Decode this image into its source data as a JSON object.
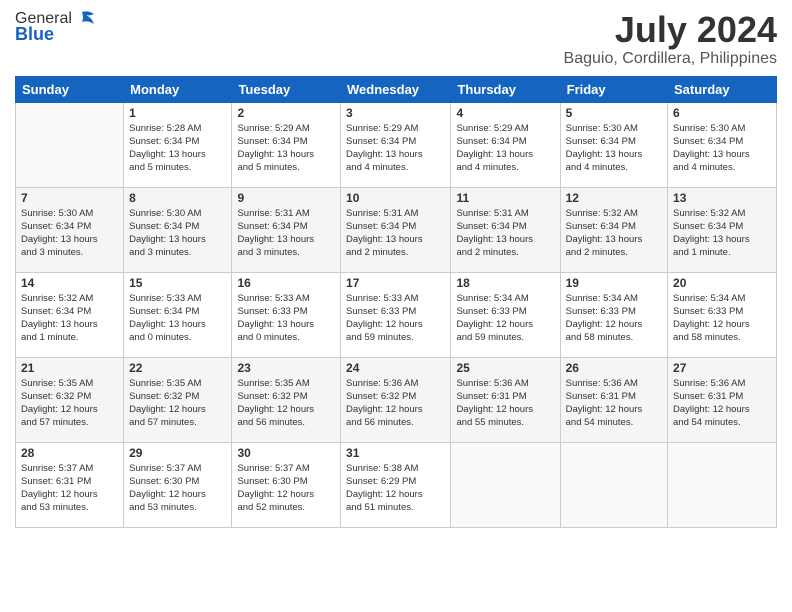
{
  "header": {
    "logo_general": "General",
    "logo_blue": "Blue",
    "month_title": "July 2024",
    "location": "Baguio, Cordillera, Philippines"
  },
  "days_of_week": [
    "Sunday",
    "Monday",
    "Tuesday",
    "Wednesday",
    "Thursday",
    "Friday",
    "Saturday"
  ],
  "weeks": [
    [
      {
        "day": "",
        "info": ""
      },
      {
        "day": "1",
        "info": "Sunrise: 5:28 AM\nSunset: 6:34 PM\nDaylight: 13 hours\nand 5 minutes."
      },
      {
        "day": "2",
        "info": "Sunrise: 5:29 AM\nSunset: 6:34 PM\nDaylight: 13 hours\nand 5 minutes."
      },
      {
        "day": "3",
        "info": "Sunrise: 5:29 AM\nSunset: 6:34 PM\nDaylight: 13 hours\nand 4 minutes."
      },
      {
        "day": "4",
        "info": "Sunrise: 5:29 AM\nSunset: 6:34 PM\nDaylight: 13 hours\nand 4 minutes."
      },
      {
        "day": "5",
        "info": "Sunrise: 5:30 AM\nSunset: 6:34 PM\nDaylight: 13 hours\nand 4 minutes."
      },
      {
        "day": "6",
        "info": "Sunrise: 5:30 AM\nSunset: 6:34 PM\nDaylight: 13 hours\nand 4 minutes."
      }
    ],
    [
      {
        "day": "7",
        "info": "Sunrise: 5:30 AM\nSunset: 6:34 PM\nDaylight: 13 hours\nand 3 minutes."
      },
      {
        "day": "8",
        "info": "Sunrise: 5:30 AM\nSunset: 6:34 PM\nDaylight: 13 hours\nand 3 minutes."
      },
      {
        "day": "9",
        "info": "Sunrise: 5:31 AM\nSunset: 6:34 PM\nDaylight: 13 hours\nand 3 minutes."
      },
      {
        "day": "10",
        "info": "Sunrise: 5:31 AM\nSunset: 6:34 PM\nDaylight: 13 hours\nand 2 minutes."
      },
      {
        "day": "11",
        "info": "Sunrise: 5:31 AM\nSunset: 6:34 PM\nDaylight: 13 hours\nand 2 minutes."
      },
      {
        "day": "12",
        "info": "Sunrise: 5:32 AM\nSunset: 6:34 PM\nDaylight: 13 hours\nand 2 minutes."
      },
      {
        "day": "13",
        "info": "Sunrise: 5:32 AM\nSunset: 6:34 PM\nDaylight: 13 hours\nand 1 minute."
      }
    ],
    [
      {
        "day": "14",
        "info": "Sunrise: 5:32 AM\nSunset: 6:34 PM\nDaylight: 13 hours\nand 1 minute."
      },
      {
        "day": "15",
        "info": "Sunrise: 5:33 AM\nSunset: 6:34 PM\nDaylight: 13 hours\nand 0 minutes."
      },
      {
        "day": "16",
        "info": "Sunrise: 5:33 AM\nSunset: 6:33 PM\nDaylight: 13 hours\nand 0 minutes."
      },
      {
        "day": "17",
        "info": "Sunrise: 5:33 AM\nSunset: 6:33 PM\nDaylight: 12 hours\nand 59 minutes."
      },
      {
        "day": "18",
        "info": "Sunrise: 5:34 AM\nSunset: 6:33 PM\nDaylight: 12 hours\nand 59 minutes."
      },
      {
        "day": "19",
        "info": "Sunrise: 5:34 AM\nSunset: 6:33 PM\nDaylight: 12 hours\nand 58 minutes."
      },
      {
        "day": "20",
        "info": "Sunrise: 5:34 AM\nSunset: 6:33 PM\nDaylight: 12 hours\nand 58 minutes."
      }
    ],
    [
      {
        "day": "21",
        "info": "Sunrise: 5:35 AM\nSunset: 6:32 PM\nDaylight: 12 hours\nand 57 minutes."
      },
      {
        "day": "22",
        "info": "Sunrise: 5:35 AM\nSunset: 6:32 PM\nDaylight: 12 hours\nand 57 minutes."
      },
      {
        "day": "23",
        "info": "Sunrise: 5:35 AM\nSunset: 6:32 PM\nDaylight: 12 hours\nand 56 minutes."
      },
      {
        "day": "24",
        "info": "Sunrise: 5:36 AM\nSunset: 6:32 PM\nDaylight: 12 hours\nand 56 minutes."
      },
      {
        "day": "25",
        "info": "Sunrise: 5:36 AM\nSunset: 6:31 PM\nDaylight: 12 hours\nand 55 minutes."
      },
      {
        "day": "26",
        "info": "Sunrise: 5:36 AM\nSunset: 6:31 PM\nDaylight: 12 hours\nand 54 minutes."
      },
      {
        "day": "27",
        "info": "Sunrise: 5:36 AM\nSunset: 6:31 PM\nDaylight: 12 hours\nand 54 minutes."
      }
    ],
    [
      {
        "day": "28",
        "info": "Sunrise: 5:37 AM\nSunset: 6:31 PM\nDaylight: 12 hours\nand 53 minutes."
      },
      {
        "day": "29",
        "info": "Sunrise: 5:37 AM\nSunset: 6:30 PM\nDaylight: 12 hours\nand 53 minutes."
      },
      {
        "day": "30",
        "info": "Sunrise: 5:37 AM\nSunset: 6:30 PM\nDaylight: 12 hours\nand 52 minutes."
      },
      {
        "day": "31",
        "info": "Sunrise: 5:38 AM\nSunset: 6:29 PM\nDaylight: 12 hours\nand 51 minutes."
      },
      {
        "day": "",
        "info": ""
      },
      {
        "day": "",
        "info": ""
      },
      {
        "day": "",
        "info": ""
      }
    ]
  ]
}
